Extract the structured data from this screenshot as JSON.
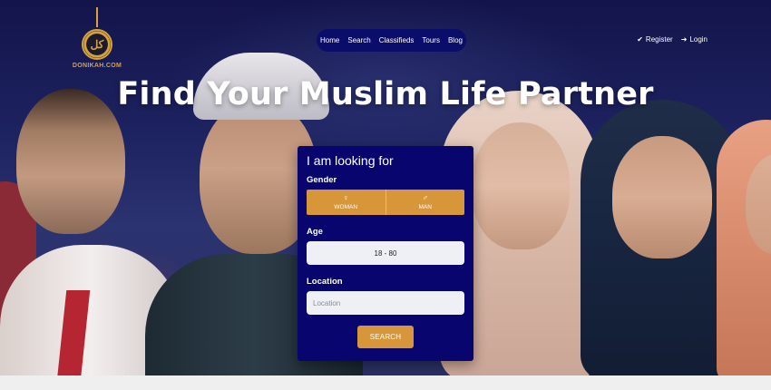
{
  "brand": {
    "name": "DONIKAH.COM",
    "logo_glyph": "كل",
    "accent_color": "#d6a23a"
  },
  "nav": {
    "items": [
      "Home",
      "Search",
      "Classifieds",
      "Tours",
      "Blog"
    ],
    "background": "#0b0d6a"
  },
  "auth": {
    "register_label": "Register",
    "login_label": "Login",
    "register_icon": "check-circle-icon",
    "login_icon": "sign-in-icon"
  },
  "hero": {
    "headline": "Find Your Muslim Life Partner"
  },
  "search_form": {
    "title": "I am looking for",
    "gender_label": "Gender",
    "gender_options": [
      {
        "label": "WOMAN",
        "icon": "female-icon"
      },
      {
        "label": "MAN",
        "icon": "male-icon"
      }
    ],
    "age_label": "Age",
    "age_value": "18 - 80",
    "location_label": "Location",
    "location_placeholder": "Location",
    "search_button": "SEARCH",
    "panel_color": "#08066e",
    "button_color": "#d7963a"
  }
}
